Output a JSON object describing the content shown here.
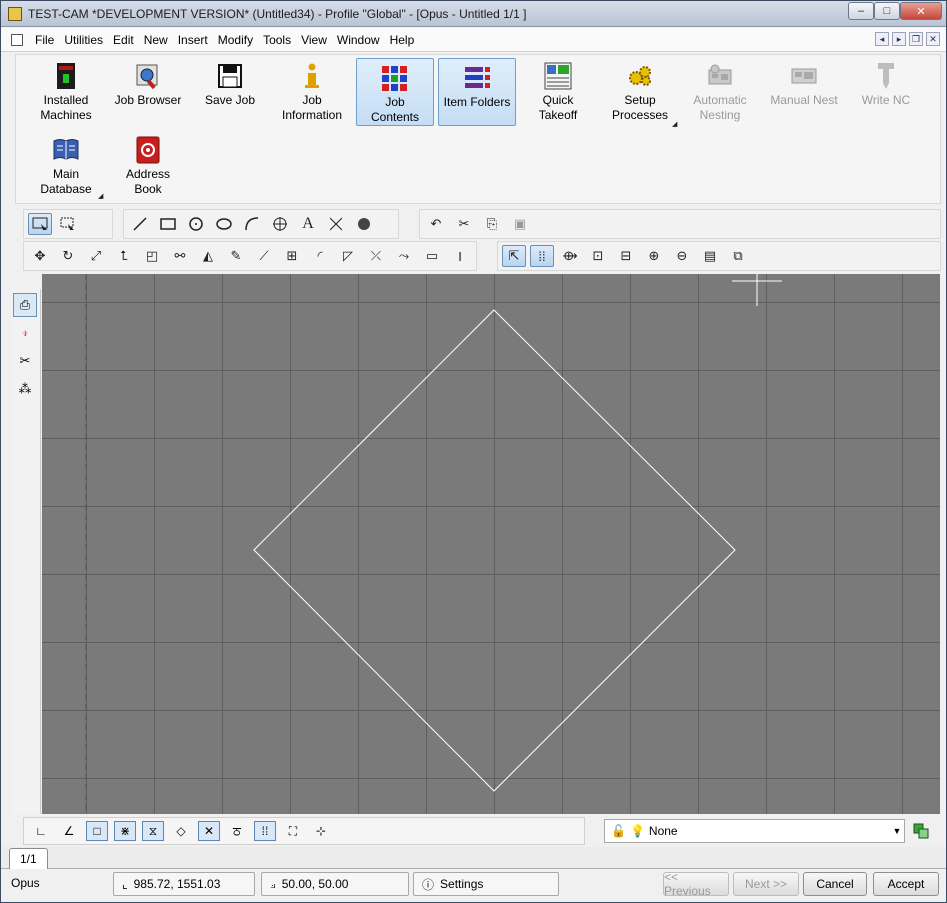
{
  "window": {
    "title": "TEST-CAM *DEVELOPMENT VERSION* (Untitled34) - Profile \"Global\" - [Opus - Untitled 1/1  ]",
    "caption": {
      "minimize": "‒",
      "maximize": "□",
      "close": "✕"
    }
  },
  "menubar": {
    "items": [
      "File",
      "Utilities",
      "Edit",
      "New",
      "Insert",
      "Modify",
      "Tools",
      "View",
      "Window",
      "Help"
    ],
    "mdi": {
      "prev": "◂",
      "next": "▸",
      "restore": "❐",
      "close": "✕"
    }
  },
  "ribbon": {
    "buttons": [
      {
        "label": "Installed\nMachines",
        "icon": "installed-machines-icon",
        "state": "normal"
      },
      {
        "label": "Job Browser",
        "icon": "job-browser-icon",
        "state": "normal"
      },
      {
        "label": "Save Job",
        "icon": "save-icon",
        "state": "normal"
      },
      {
        "label": "Job\nInformation",
        "icon": "info-icon",
        "state": "normal"
      },
      {
        "label": "Job\nContents",
        "icon": "job-contents-icon",
        "state": "active"
      },
      {
        "label": "Item Folders",
        "icon": "item-folders-icon",
        "state": "active"
      },
      {
        "label": "Quick\nTakeoff",
        "icon": "quick-takeoff-icon",
        "state": "normal"
      },
      {
        "label": "Setup\nProcesses",
        "icon": "setup-processes-icon",
        "state": "normal",
        "dropdown": true
      },
      {
        "label": "Automatic\nNesting",
        "icon": "automatic-nesting-icon",
        "state": "disabled"
      },
      {
        "label": "Manual Nest",
        "icon": "manual-nest-icon",
        "state": "disabled"
      },
      {
        "label": "Write NC",
        "icon": "write-nc-icon",
        "state": "disabled"
      },
      {
        "label": "Main\nDatabase",
        "icon": "main-database-icon",
        "state": "normal",
        "dropdown": true
      },
      {
        "label": "Address\nBook",
        "icon": "address-book-icon",
        "state": "normal"
      }
    ]
  },
  "draw_toolbar": [
    "select-icon",
    "lasso-select-icon",
    "line-icon",
    "rectangle-icon",
    "circle-icon",
    "ellipse-icon",
    "arc-icon",
    "point-icon",
    "text-icon",
    "dimension-icon",
    "hatch-icon",
    "undo-icon",
    "cut-icon",
    "copy-icon",
    "paste-icon"
  ],
  "modify_toolbar": [
    "move-icon",
    "rotate-icon",
    "scale-icon",
    "stretch-icon",
    "offset-icon",
    "array-icon",
    "mirror-icon",
    "edit-icon",
    "break-icon",
    "grid-icon",
    "fillet-icon",
    "chamfer-icon",
    "trim-icon",
    "extend-icon",
    "bounding-box-icon",
    "text-cursor-icon",
    "snap-pointer-icon",
    "grid-toggle-icon",
    "zoom-extents-icon",
    "zoom-window-icon",
    "zoom-previous-icon",
    "zoom-in-icon",
    "zoom-out-icon",
    "properties-icon",
    "window-icon"
  ],
  "left_toolbar": [
    "view-icon",
    "pin-icon",
    "scissors-icon",
    "node-icon"
  ],
  "snap_toolbar": [
    "ortho-icon",
    "angle-icon",
    "endpoint-snap-icon",
    "midpoint-snap-icon",
    "intersection-snap-icon",
    "center-snap-icon",
    "quadrant-snap-icon",
    "nearest-snap-icon",
    "grid-snap-icon",
    "extents-icon",
    "crosshair-icon"
  ],
  "layer": {
    "name": "None",
    "arrow": "▼"
  },
  "sheet_tab": "1/1",
  "status": {
    "app": "Opus",
    "coordinates": "985.72, 1551.03",
    "grid_spacing": "50.00, 50.00",
    "settings": "Settings",
    "prev": "<< Previous",
    "next": "Next >>",
    "cancel": "Cancel",
    "accept": "Accept"
  },
  "colors": {
    "canvas": "#7a7a7a",
    "grid": "#5e5e5e",
    "shape": "#ffffff"
  }
}
